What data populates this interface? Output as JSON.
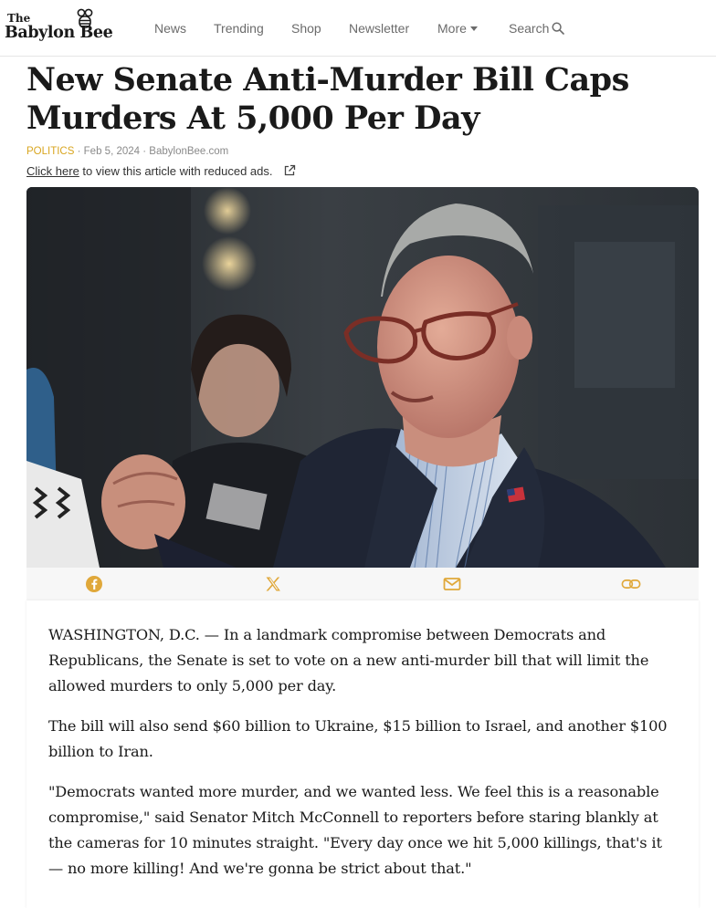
{
  "site": {
    "logo_the": "The",
    "logo_name": "Babylon Bee"
  },
  "nav": {
    "news": "News",
    "trending": "Trending",
    "shop": "Shop",
    "newsletter": "Newsletter",
    "more": "More",
    "search": "Search"
  },
  "article": {
    "title_line1": "New Senate Anti-Murder Bill Caps",
    "title_line2": "Murders At 5,000 Per Day",
    "category": "POLITICS",
    "date": "Feb 5, 2024",
    "source": "BabylonBee.com",
    "separator": "·",
    "reduced_ads_link": "Click here",
    "reduced_ads_text": " to view this article with reduced ads.",
    "paragraphs": [
      "WASHINGTON, D.C. — In a landmark compromise between Democrats and Republicans, the Senate is set to vote on a new anti-murder bill that will limit the allowed murders to only 5,000 per day.",
      "The bill will also send $60 billion to Ukraine, $15 billion to Israel, and another $100 billion to Iran.",
      "\"Democrats wanted more murder, and we wanted less. We feel this is a reasonable compromise,\" said Senator Mitch McConnell to reporters before staring blankly at the cameras for 10 minutes straight. \"Every day once we hit 5,000 killings, that's it — no more killing! And we're gonna be strict about that.\""
    ]
  },
  "share": {
    "icons": [
      "facebook-icon",
      "x-icon",
      "email-icon",
      "link-icon"
    ]
  },
  "colors": {
    "category": "#d9a620",
    "share_icon": "#e0a83a",
    "nav_text": "#6b6b6b"
  }
}
